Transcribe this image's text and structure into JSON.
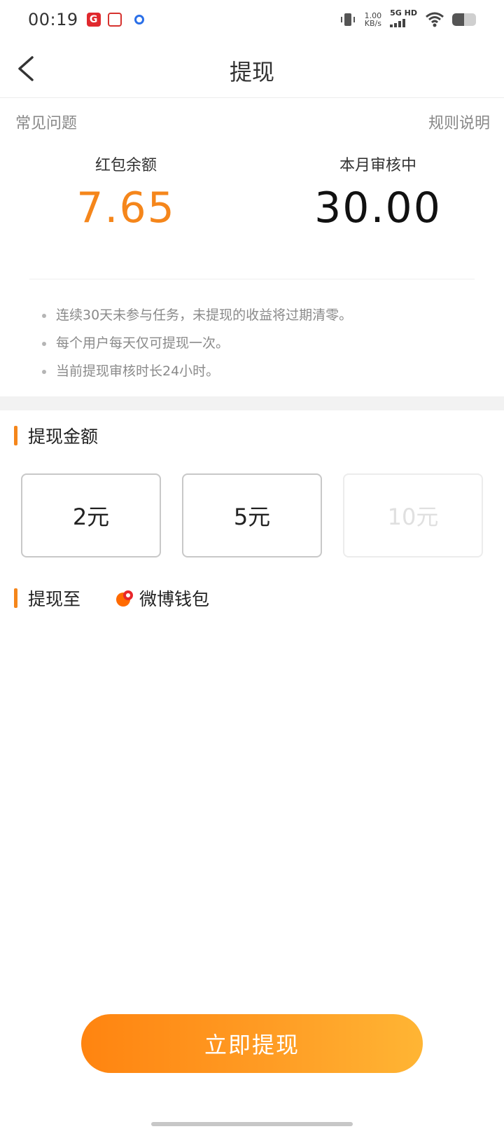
{
  "status_bar": {
    "time": "00:19",
    "speed_value": "1.00",
    "speed_unit": "KB/s",
    "network": "5G HD",
    "icons": [
      "app-icon-1",
      "app-icon-2",
      "app-icon-3",
      "vibrate-icon",
      "signal-icon",
      "wifi-icon",
      "battery-icon"
    ]
  },
  "header": {
    "title": "提现",
    "back_icon": "chevron-left-icon"
  },
  "links": {
    "faq": "常见问题",
    "rules": "规则说明"
  },
  "balances": {
    "red_packet_label": "红包余额",
    "red_packet_value": "7.65",
    "pending_label": "本月审核中",
    "pending_value": "30.00"
  },
  "notes": [
    "连续30天未参与任务，未提现的收益将过期清零。",
    "每个用户每天仅可提现一次。",
    "当前提现审核时长24小时。"
  ],
  "amount_section": {
    "title": "提现金额",
    "options": [
      {
        "label": "2元",
        "enabled": true
      },
      {
        "label": "5元",
        "enabled": true
      },
      {
        "label": "10元",
        "enabled": false
      }
    ]
  },
  "destination": {
    "title": "提现至",
    "wallet_label": "微博钱包",
    "wallet_icon": "weibo-wallet-icon"
  },
  "action": {
    "withdraw_label": "立即提现"
  },
  "colors": {
    "accent": "#f5861b",
    "button_gradient_start": "#ff8410",
    "button_gradient_end": "#ffb534"
  }
}
